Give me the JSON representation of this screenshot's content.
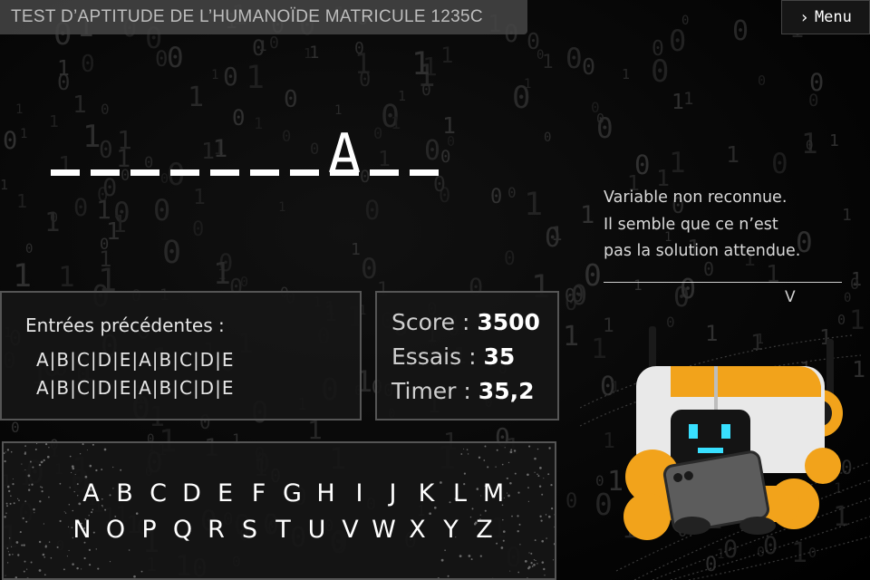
{
  "header": {
    "title": "TEST D’APTITUDE DE L’HUMANOÏDE MATRICULE 1235C",
    "menu_label": "Menu",
    "menu_icon": "chevron-right-icon"
  },
  "word": {
    "slots": [
      "",
      "",
      "",
      "",
      "",
      "",
      "",
      "A",
      "",
      ""
    ]
  },
  "feedback": {
    "lines": [
      "Variable non reconnue.",
      "Il semble que ce n’est",
      "pas la solution attendue."
    ],
    "arrow": "V"
  },
  "previous": {
    "title": "Entrées précédentes :",
    "row1": "A|B|C|D|E|A|B|C|D|E",
    "row2": "A|B|C|D|E|A|B|C|D|E"
  },
  "stats": {
    "score_label": "Score :",
    "score_value": "3500",
    "tries_label": "Essais :",
    "tries_value": "35",
    "timer_label": "Timer :",
    "timer_value": "35,2"
  },
  "keyboard": {
    "row1": [
      "A",
      "B",
      "C",
      "D",
      "E",
      "F",
      "G",
      "H",
      "I",
      "J",
      "K",
      "L",
      "M"
    ],
    "row2": [
      "N",
      "O",
      "P",
      "Q",
      "R",
      "S",
      "T",
      "U",
      "V",
      "W",
      "X",
      "Y",
      "Z"
    ]
  },
  "colors": {
    "background": "#000000",
    "panel_border": "#555555",
    "robot_accent": "#f2a31b",
    "robot_screen": "#38e0ff"
  }
}
